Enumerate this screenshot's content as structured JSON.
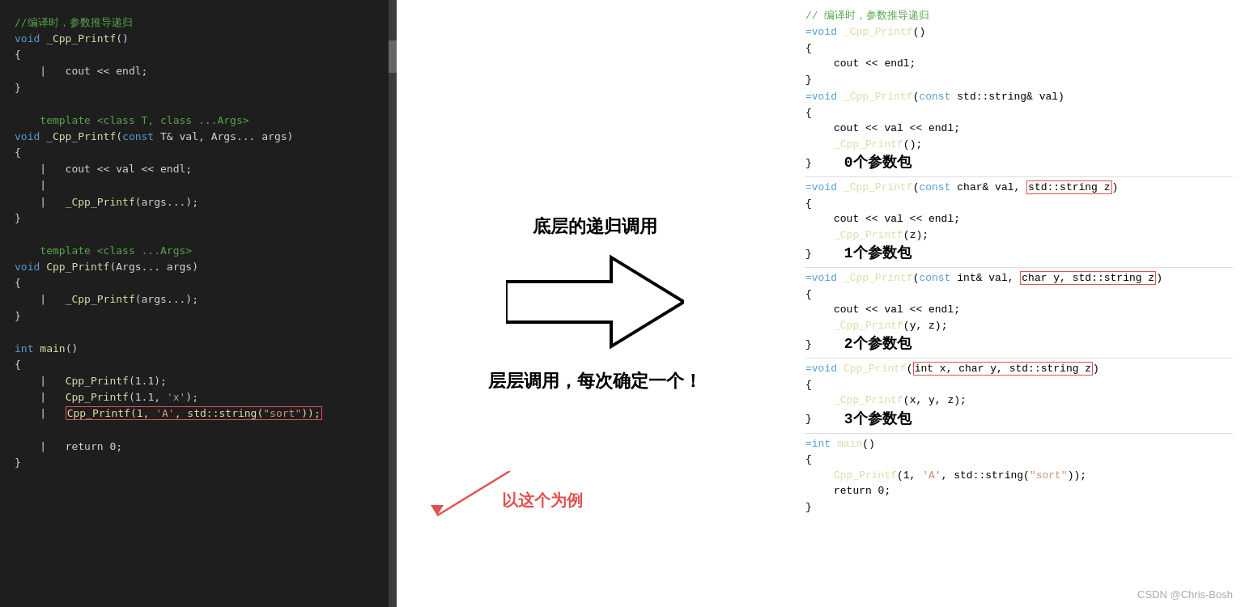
{
  "left_panel": {
    "lines": [
      {
        "text": "    //编译时，参数推导递归",
        "color": "green"
      },
      {
        "text": "⊟void _Cpp_Printf()",
        "color": "mixed_kw_fn"
      },
      {
        "text": "    {",
        "color": "white"
      },
      {
        "text": "    |   cout << endl;",
        "color": "white"
      },
      {
        "text": "    }",
        "color": "white"
      },
      {
        "text": "",
        "color": "white"
      },
      {
        "text": "    template <class T, class ...Args>",
        "color": "green"
      },
      {
        "text": "⊟void _Cpp_Printf(const T& val, Args... args)",
        "color": "mixed"
      },
      {
        "text": "    {",
        "color": "white"
      },
      {
        "text": "    |   cout << val << endl;",
        "color": "white"
      },
      {
        "text": "    |   ",
        "color": "white"
      },
      {
        "text": "    |   _Cpp_Printf(args...);",
        "color": "white"
      },
      {
        "text": "    }",
        "color": "white"
      },
      {
        "text": "",
        "color": "white"
      },
      {
        "text": "    template <class ...Args>",
        "color": "green"
      },
      {
        "text": "⊟void Cpp_Printf(Args... args)",
        "color": "mixed"
      },
      {
        "text": "    {",
        "color": "white"
      },
      {
        "text": "    |   _Cpp_Printf(args...);",
        "color": "white"
      },
      {
        "text": "    }",
        "color": "white"
      },
      {
        "text": "",
        "color": "white"
      },
      {
        "text": "⊟int main()",
        "color": "mixed_kw"
      },
      {
        "text": "    {",
        "color": "white"
      },
      {
        "text": "    |   Cpp_Printf(1.1);",
        "color": "white"
      },
      {
        "text": "    |   Cpp_Printf(1.1, 'x');",
        "color": "white"
      },
      {
        "text": "    |   Cpp_Printf(1, 'A', std::string(\"sort\"));",
        "color": "highlight_red"
      },
      {
        "text": "",
        "color": "white"
      },
      {
        "text": "    |   return 0;",
        "color": "white"
      },
      {
        "text": "    }",
        "color": "white"
      }
    ]
  },
  "annotations": {
    "top_label": "底层的递归调用",
    "bottom_label": "层层调用，每次确定一个！",
    "example_label": "以这个为例"
  },
  "right_panel": {
    "top_comment": "// 编译时，参数推导递归",
    "sections": [
      {
        "id": "s0",
        "signature": "=void _Cpp_Printf()",
        "body_lines": [
          "{",
          "    cout << endl;",
          "}"
        ],
        "label": null,
        "highlight": null
      },
      {
        "id": "s1",
        "signature": "=void _Cpp_Printf(const std::string& val)",
        "body_lines": [
          "{",
          "    cout << val << endl;",
          "    _Cpp_Printf();",
          "}"
        ],
        "label": "0个参数包",
        "highlight": null
      },
      {
        "id": "s2",
        "signature_prefix": "=void _Cpp_Printf(const char& val, ",
        "signature_highlight": "std::string z",
        "signature_suffix": ")",
        "body_lines": [
          "{",
          "    cout << val << endl;",
          "    _Cpp_Printf(z);",
          "}"
        ],
        "label": "1个参数包",
        "highlight": "std::string z"
      },
      {
        "id": "s3",
        "signature_prefix": "=void _Cpp_Printf(const int& val, ",
        "signature_highlight": "char y, std::string z",
        "signature_suffix": ")",
        "body_lines": [
          "{",
          "    cout << val << endl;",
          "    _Cpp_Printf(y, z);",
          "}"
        ],
        "label": "2个参数包",
        "highlight": "char y, std::string z"
      },
      {
        "id": "s4",
        "signature_prefix": "=void Cpp_Printf(",
        "signature_highlight": "int x, char y, std::string z",
        "signature_suffix": ")",
        "body_lines": [
          "{",
          "    _Cpp_Printf(x, y, z);",
          "}"
        ],
        "label": "3个参数包",
        "highlight": "int x, char y, std::string z"
      },
      {
        "id": "s5",
        "signature": "=int main()",
        "body_lines": [
          "{",
          "    Cpp_Printf(1, 'A', std::string(\"sort\"));",
          "",
          "    return 0;",
          "}"
        ],
        "label": null,
        "highlight": null
      }
    ]
  },
  "watermark": "CSDN @Chris-Bosh"
}
